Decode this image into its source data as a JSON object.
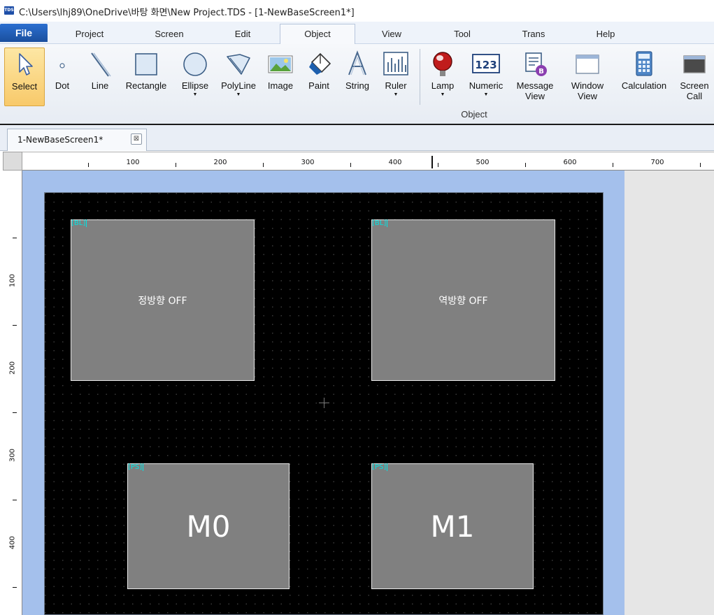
{
  "window": {
    "app_icon_text": "TDS",
    "title": "C:\\Users\\lhj89\\OneDrive\\바탕 화면\\New Project.TDS - [1-NewBaseScreen1*]"
  },
  "menubar": {
    "file": "File",
    "tabs": [
      "Project",
      "Screen",
      "Edit",
      "Object",
      "View",
      "Tool",
      "Trans",
      "Help"
    ],
    "active_tab": "Object"
  },
  "ribbon": {
    "tools": {
      "select": "Select",
      "dot": "Dot",
      "line": "Line",
      "rectangle": "Rectangle",
      "ellipse": "Ellipse",
      "polyline": "PolyLine",
      "image": "Image",
      "paint": "Paint",
      "string": "String",
      "ruler": "Ruler",
      "lamp": "Lamp",
      "numeric": "Numeric",
      "numeric_icon_text": "123",
      "message_view_1": "Message",
      "message_view_2": "View",
      "window_view_1": "Window",
      "window_view_2": "View",
      "calculation": "Calculation",
      "screen_call_1": "Screen",
      "screen_call_2": "Call"
    },
    "group_label": "Object",
    "dropdown_arrow": "▼"
  },
  "document_tab": {
    "label": "1-NewBaseScreen1*",
    "close_glyph": "⊠"
  },
  "rulers": {
    "h_labels": [
      "100",
      "200",
      "300",
      "400",
      "500",
      "600",
      "700"
    ],
    "v_labels": [
      "100",
      "200",
      "300",
      "400"
    ]
  },
  "canvas": {
    "objects": [
      {
        "tag": "[BL]",
        "label": "정방향 OFF"
      },
      {
        "tag": "[BL]",
        "label": "역방향 OFF"
      },
      {
        "tag": "[PS]",
        "label": "M0"
      },
      {
        "tag": "[PS]",
        "label": "M1"
      }
    ],
    "background_color": "#000000",
    "object_color": "#808080",
    "tag_color": "#00e5e5"
  }
}
